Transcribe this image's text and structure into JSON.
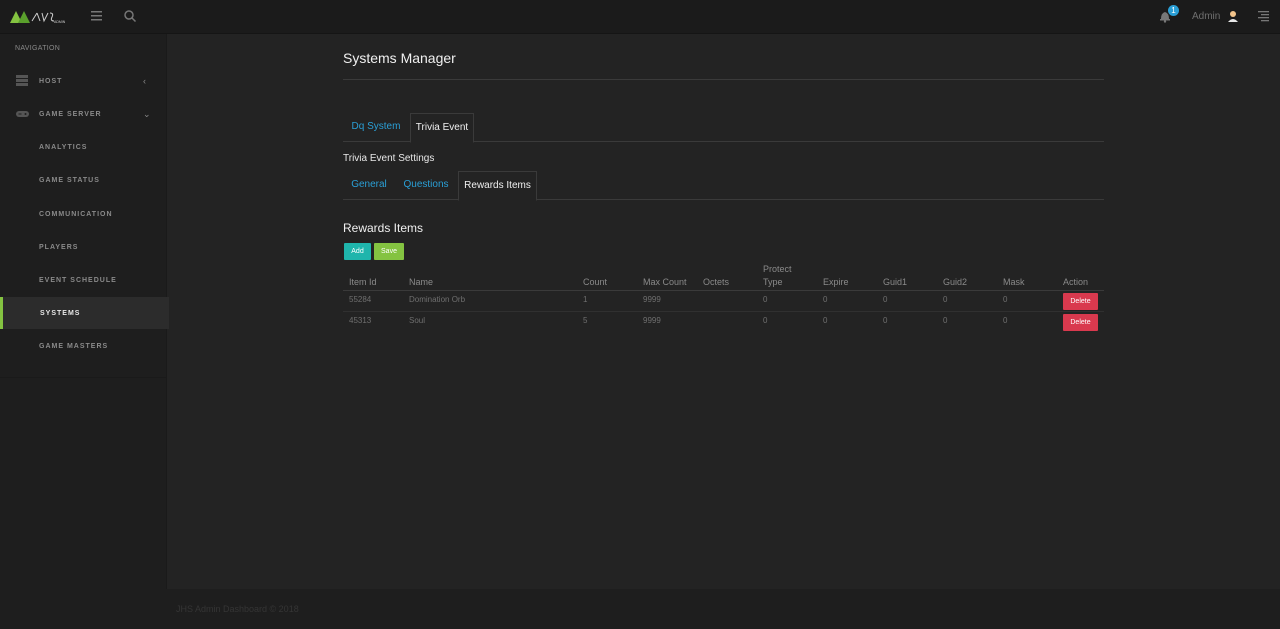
{
  "topbar": {
    "notification_count": "1",
    "admin_name": "Admin"
  },
  "sidebar": {
    "nav_title": "NAVIGATION",
    "items": [
      {
        "label": "HOST",
        "icon": "server-icon",
        "expandable": true
      },
      {
        "label": "GAME SERVER",
        "icon": "gamepad-icon",
        "expandable": true
      },
      {
        "label": "ANALYTICS"
      },
      {
        "label": "GAME STATUS"
      },
      {
        "label": "COMMUNICATION"
      },
      {
        "label": "PLAYERS"
      },
      {
        "label": "EVENT SCHEDULE"
      },
      {
        "label": "SYSTEMS",
        "active": true
      },
      {
        "label": "GAME MASTERS"
      }
    ]
  },
  "main": {
    "page_title": "Systems Manager",
    "tabs": [
      {
        "label": "Dq System"
      },
      {
        "label": "Trivia Event",
        "active": true
      }
    ],
    "section_title": "Trivia Event Settings",
    "subtabs": [
      {
        "label": "General"
      },
      {
        "label": "Questions"
      },
      {
        "label": "Rewards Items",
        "active": true
      }
    ],
    "rewards_title": "Rewards Items",
    "add_label": "Add",
    "save_label": "Save",
    "table": {
      "headers": {
        "item_id": "Item Id",
        "name": "Name",
        "count": "Count",
        "max_count": "Max Count",
        "octets": "Octets",
        "protect_1": "Protect",
        "protect_2": "Type",
        "expire": "Expire",
        "guid1": "Guid1",
        "guid2": "Guid2",
        "mask": "Mask",
        "action": "Action"
      },
      "rows": [
        {
          "item_id": "55284",
          "name": "Domination Orb",
          "count": "1",
          "max_count": "9999",
          "octets": "",
          "protect_type": "0",
          "expire": "0",
          "guid1": "0",
          "guid2": "0",
          "mask": "0",
          "action": "Delete"
        },
        {
          "item_id": "45313",
          "name": "Soul",
          "count": "5",
          "max_count": "9999",
          "octets": "",
          "protect_type": "0",
          "expire": "0",
          "guid1": "0",
          "guid2": "0",
          "mask": "0",
          "action": "Delete"
        }
      ]
    }
  },
  "footer": {
    "text": "JHS Admin Dashboard   © 2018"
  },
  "colors": {
    "accent_blue": "#2a9fd6",
    "accent_green": "#84c341",
    "add_teal": "#1fb5ac",
    "delete_red": "#d9394e"
  }
}
